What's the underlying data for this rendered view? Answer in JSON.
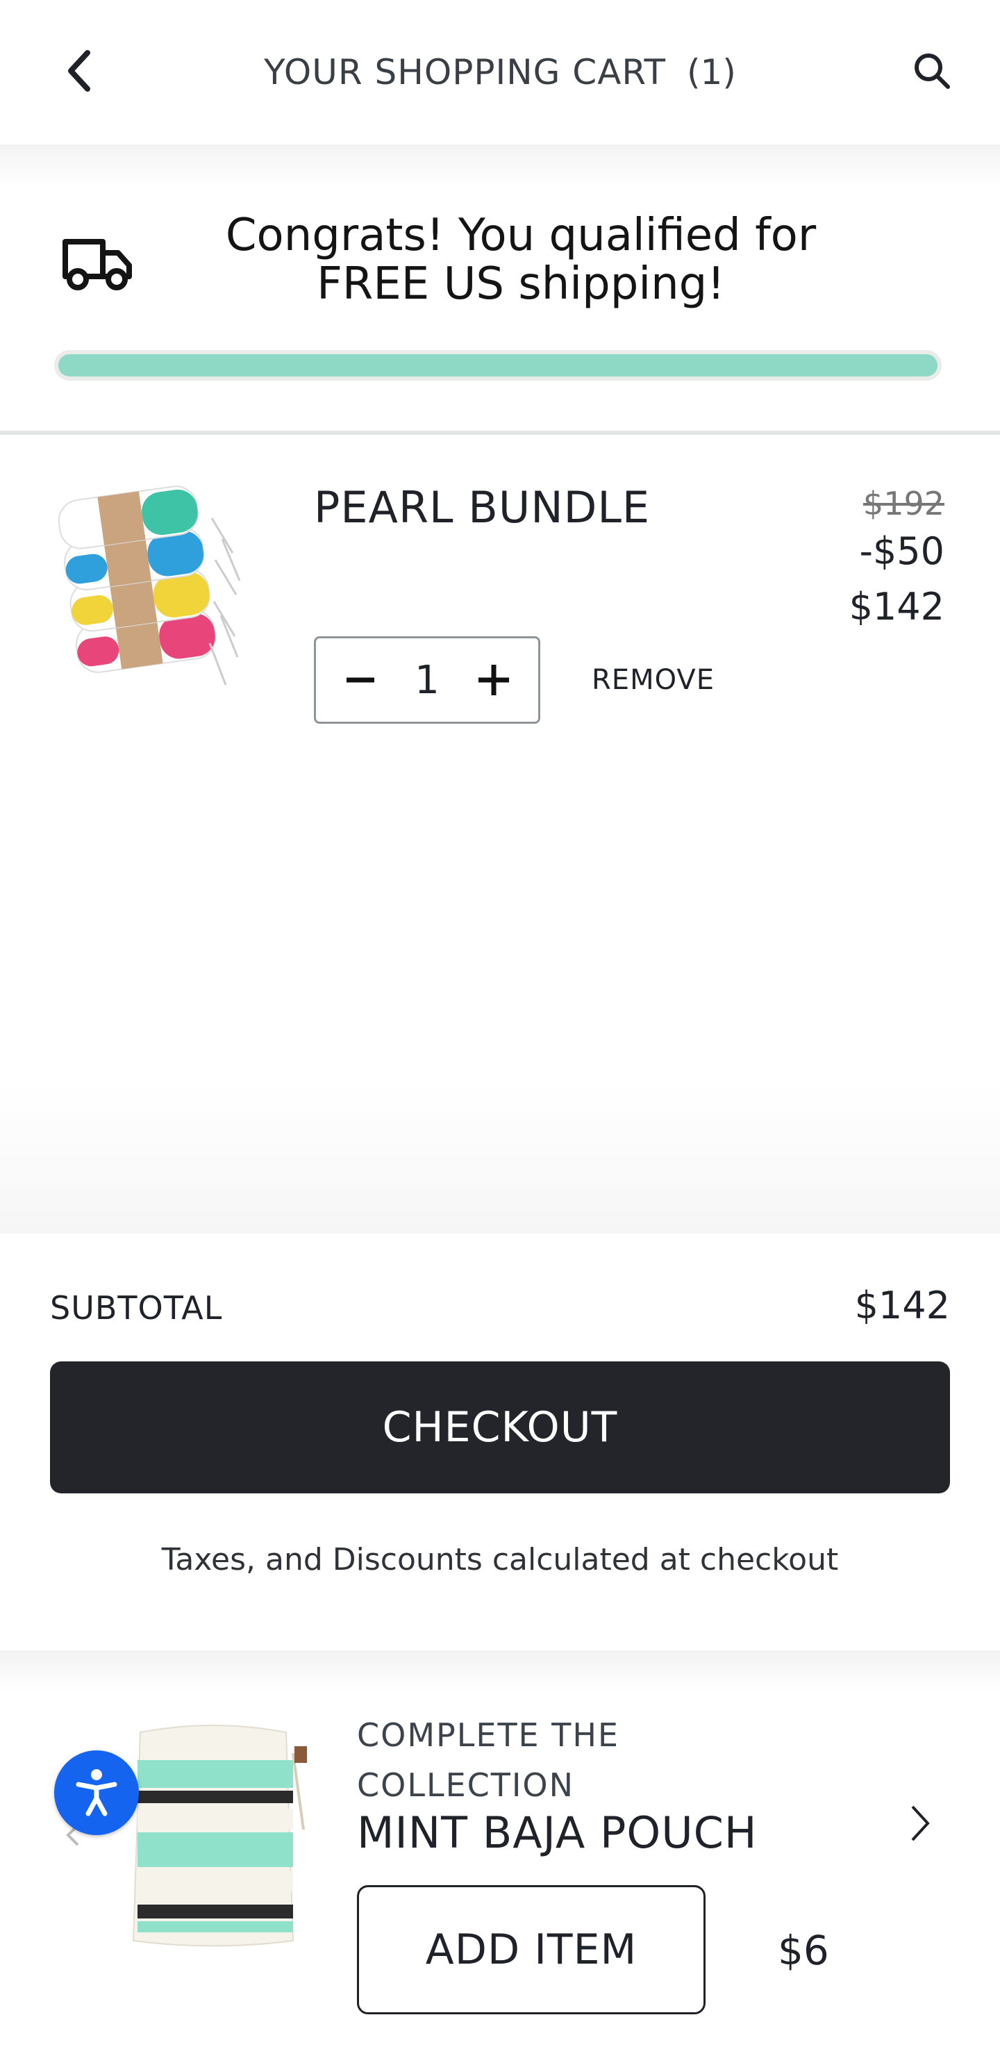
{
  "header": {
    "title": "YOUR SHOPPING CART",
    "count": "(1)",
    "back_icon": "chevron-left-icon",
    "search_icon": "search-icon"
  },
  "shipping_banner": {
    "message": "Congrats! You qualified for FREE US shipping!",
    "progress_percent": 100,
    "progress_color": "#8ed8c6",
    "icon": "truck-icon"
  },
  "cart_items": [
    {
      "title": "PEARL BUNDLE",
      "price_original": "$192",
      "price_discount": "-$50",
      "price_final": "$142",
      "quantity": "1",
      "remove_label": "REMOVE"
    }
  ],
  "summary": {
    "subtotal_label": "SUBTOTAL",
    "subtotal_value": "$142",
    "checkout_label": "CHECKOUT",
    "tax_note": "Taxes, and Discounts calculated at checkout",
    "checkout_bg": "#23252a"
  },
  "upsell": {
    "kicker": "COMPLETE THE COLLECTION",
    "title": "MINT BAJA POUCH",
    "add_label": "ADD ITEM",
    "price": "$6",
    "accessibility_color": "#1464ef"
  }
}
